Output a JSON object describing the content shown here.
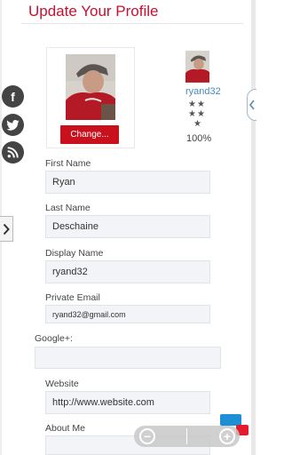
{
  "header": {
    "title": "Update Your Profile"
  },
  "social": [
    {
      "name": "facebook",
      "glyph": "f"
    },
    {
      "name": "twitter",
      "glyph": "t"
    },
    {
      "name": "rss",
      "glyph": ")"
    }
  ],
  "profile": {
    "change_label": "Change...",
    "username": "ryand32",
    "stars_row1": "★★",
    "stars_row2": "★★",
    "stars_row3": "★",
    "completion": "100%"
  },
  "form": {
    "first_name": {
      "label": "First Name",
      "value": "Ryan"
    },
    "last_name": {
      "label": "Last Name",
      "value": "Deschaine"
    },
    "display_name": {
      "label": "Display Name",
      "value": "ryand32"
    },
    "private_email": {
      "label": "Private Email",
      "value": "ryand32@gmail.com"
    },
    "google_plus": {
      "label": "Google+:",
      "value": ""
    },
    "website": {
      "label": "Website",
      "value": "http://www.website.com"
    },
    "about_me": {
      "label": "About Me",
      "value": ""
    }
  },
  "colors": {
    "accent": "#c8102e",
    "button": "#c9101d",
    "link": "#4a8abf",
    "field_bg": "#f2f4f8"
  }
}
